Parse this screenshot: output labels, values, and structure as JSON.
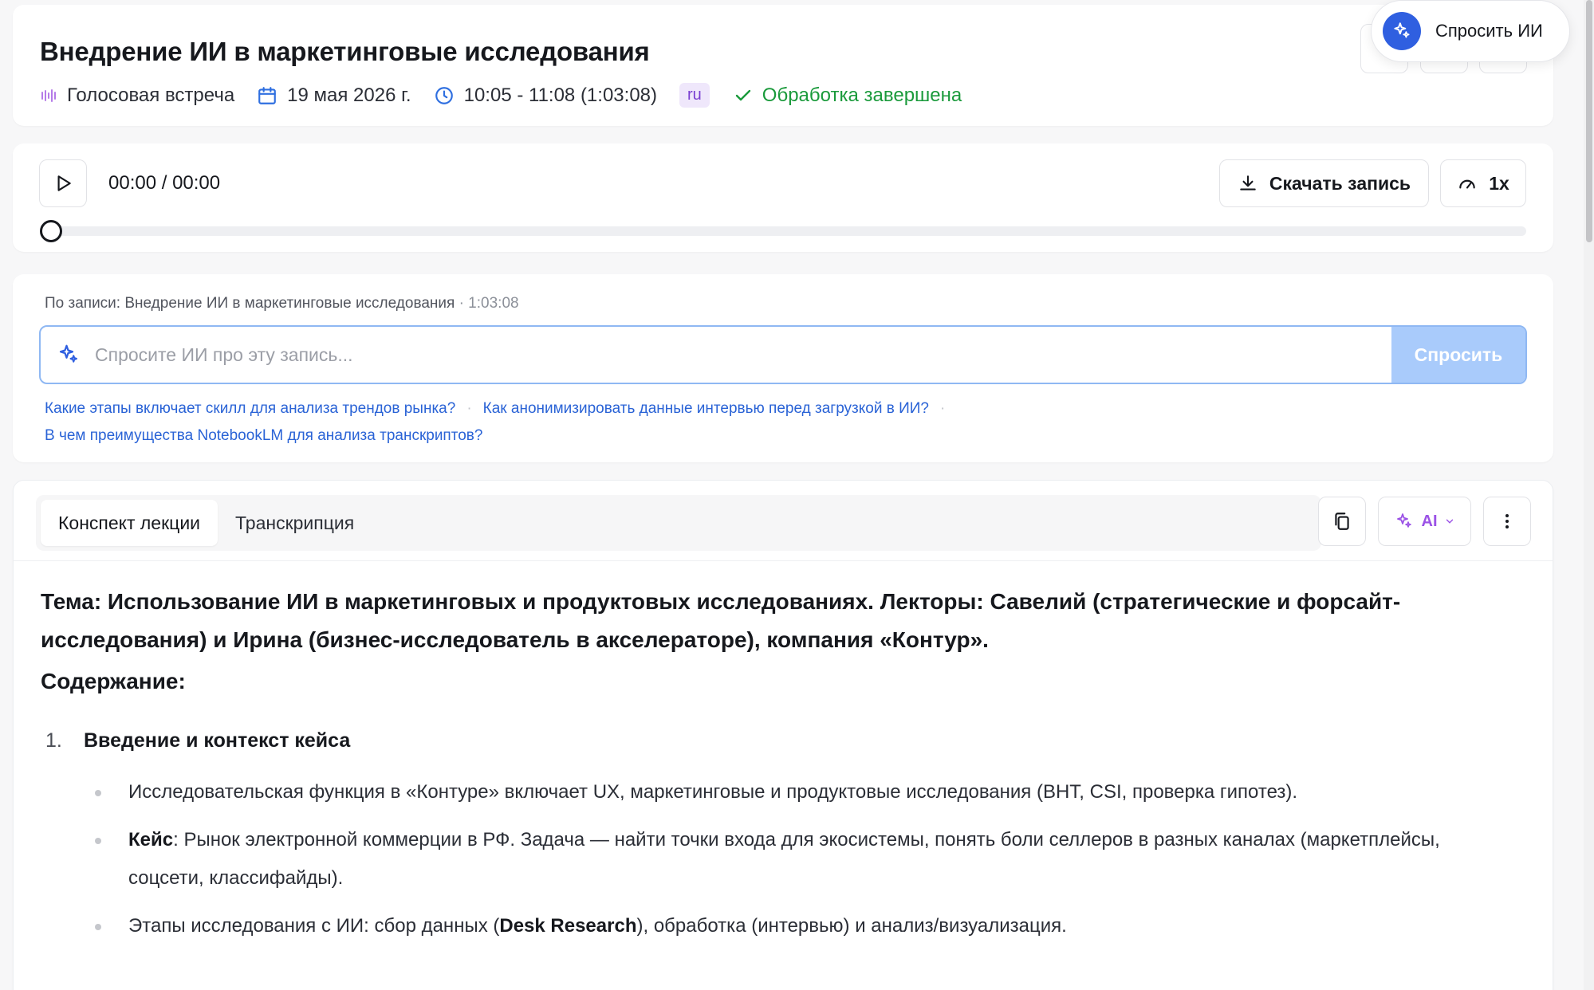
{
  "header": {
    "title": "Внедрение ИИ в маркетинговые исследования",
    "meeting_type": "Голосовая встреча",
    "date": "19 мая 2026 г.",
    "time_range": "10:05 - 11:08 (1:03:08)",
    "language": "ru",
    "status": "Обработка завершена"
  },
  "floating_ask": {
    "label": "Спросить ИИ"
  },
  "player": {
    "time": "00:00 / 00:00",
    "progress": 0,
    "download_label": "Скачать запись",
    "speed_label": "1x"
  },
  "ask": {
    "context_prefix": "По записи: Внедрение ИИ в маркетинговые исследования",
    "context_duration": "· 1:03:08",
    "placeholder": "Спросите ИИ про эту запись...",
    "submit_label": "Спросить",
    "suggestions": [
      "Какие этапы включает скилл для анализа трендов рынка?",
      "Как анонимизировать данные интервью перед загрузкой в ИИ?",
      "В чем преимущества NotebookLM для анализа транскриптов?"
    ]
  },
  "notes": {
    "tabs": [
      "Конспект лекции",
      "Транскрипция"
    ],
    "active_tab": 0,
    "ai_label": "AI",
    "topic": "Тема: Использование ИИ в маркетинговых и продуктовых исследованиях. Лекторы: Савелий (стратегические и форсайт-исследования) и Ирина (бизнес-исследователь в акселераторе), компания «Контур».",
    "contents_heading": "Содержание:",
    "section1": {
      "number": "1.",
      "title": "Введение и контекст кейса",
      "bullet1": "Исследовательская функция в «Контуре» включает UX, маркетинговые и продуктовые исследования (BHT, CSI, проверка гипотез).",
      "bullet2_bold": "Кейс",
      "bullet2_rest": ": Рынок электронной коммерции в РФ. Задача — найти точки входа для экосистемы, понять боли селлеров в разных каналах (маркетплейсы, соцсети, классифайды).",
      "bullet3_start": "Этапы исследования с ИИ: сбор данных (",
      "bullet3_bold": "Desk Research",
      "bullet3_end": "), обработка (интервью) и анализ/визуализация."
    }
  },
  "colors": {
    "accent": "#2f5fe0",
    "status_green": "#1a9a3b",
    "link_blue": "#2a63d6",
    "ai_purple": "#9b52e6",
    "submit_disabled": "#a9cbfb"
  }
}
